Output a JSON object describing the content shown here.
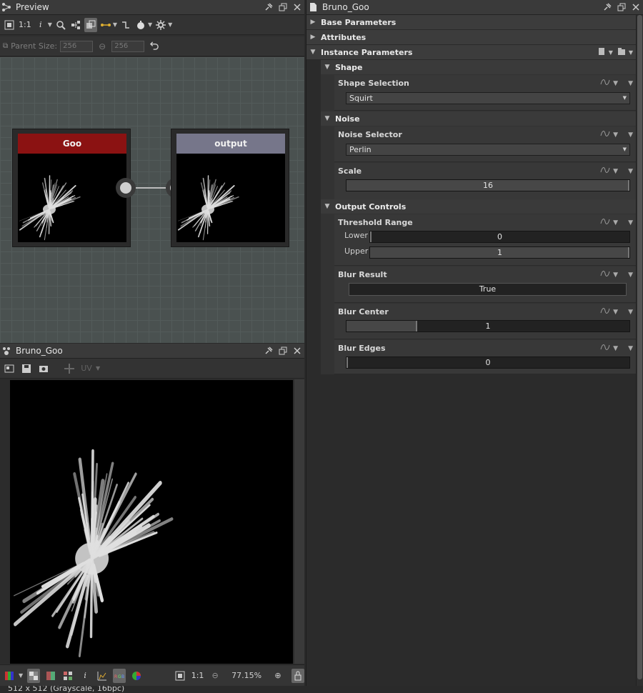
{
  "preview": {
    "title": "Preview",
    "toolbar": {
      "ratio_label": "1:1",
      "info_label": "i"
    },
    "parent_size": {
      "label": "Parent Size:",
      "width": "256",
      "height": "256"
    },
    "nodes": {
      "goo": {
        "title": "Goo",
        "header_color": "#8b1212"
      },
      "output": {
        "title": "output",
        "header_color": "#76768a"
      }
    }
  },
  "viewer": {
    "title": "Bruno_Goo",
    "uv_label": "UV",
    "image_info": "512 x 512 (Grayscale, 16bpc)",
    "bottom": {
      "info_label": "i",
      "ratio_label": "1:1",
      "zoom": "77.15%"
    }
  },
  "right": {
    "title": "Bruno_Goo",
    "sections": {
      "base": "Base Parameters",
      "attributes": "Attributes",
      "instance": "Instance Parameters"
    },
    "groups": {
      "shape": "Shape",
      "noise": "Noise",
      "output_controls": "Output Controls"
    },
    "params": {
      "shape_selection": {
        "label": "Shape Selection",
        "value": "Squirt"
      },
      "noise_selector": {
        "label": "Noise Selector",
        "value": "Perlin"
      },
      "scale": {
        "label": "Scale",
        "value": "16",
        "fraction": 1.0
      },
      "threshold_range": {
        "label": "Threshold Range",
        "lower_label": "Lower",
        "lower_value": "0",
        "lower_fraction": 0.0,
        "upper_label": "Upper",
        "upper_value": "1",
        "upper_fraction": 1.0
      },
      "blur_result": {
        "label": "Blur Result",
        "value": "True"
      },
      "blur_center": {
        "label": "Blur Center",
        "value": "1",
        "fraction": 0.25
      },
      "blur_edges": {
        "label": "Blur Edges",
        "value": "0",
        "fraction": 0.0
      }
    }
  }
}
